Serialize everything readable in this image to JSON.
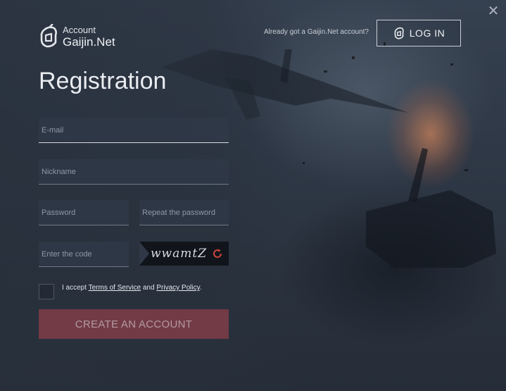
{
  "header": {
    "brand_top": "Account",
    "brand_bottom": "Gaijin.Net",
    "already_text": "Already got a Gaijin.Net account?",
    "login_label": "LOG IN",
    "close_symbol": "✕"
  },
  "form": {
    "title": "Registration",
    "email_placeholder": "E-mail",
    "nickname_placeholder": "Nickname",
    "password_placeholder": "Password",
    "repeat_placeholder": "Repeat the password",
    "code_placeholder": "Enter the code",
    "captcha_text": "wwamtZ",
    "accept_prefix": "I accept ",
    "terms_label": "Terms of Service",
    "accept_and": " and ",
    "privacy_label": "Privacy Policy",
    "accept_suffix": ".",
    "create_label": "CREATE AN ACCOUNT"
  },
  "icons": {
    "brand": "gaijin-logo-icon",
    "login": "gaijin-logo-icon",
    "close": "close-icon",
    "refresh": "refresh-icon"
  },
  "colors": {
    "create_button": "#723b45",
    "refresh": "#d0453c",
    "background": "#2b3340"
  }
}
